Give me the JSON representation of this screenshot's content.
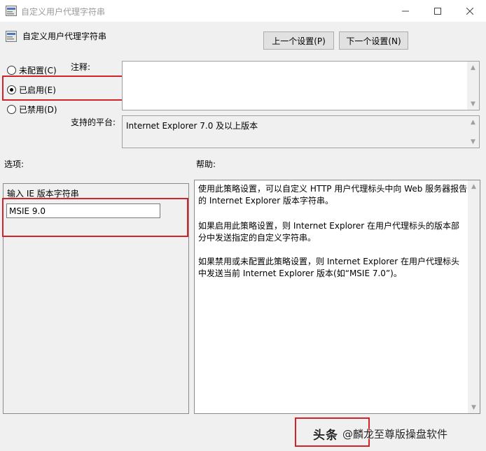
{
  "window": {
    "title": "自定义用户代理字符串",
    "controls": [
      "minimize-icon",
      "maximize-icon",
      "close-icon"
    ]
  },
  "header": {
    "title": "自定义用户代理字符串",
    "prev_button": "上一个设置(P)",
    "next_button": "下一个设置(N)"
  },
  "state": {
    "options": [
      {
        "label": "未配置(C)",
        "checked": false
      },
      {
        "label": "已启用(E)",
        "checked": true
      },
      {
        "label": "已禁用(D)",
        "checked": false
      }
    ]
  },
  "comment": {
    "label": "注释:",
    "value": ""
  },
  "platform": {
    "label": "支持的平台:",
    "value": "Internet Explorer 7.0 及以上版本"
  },
  "options_section": {
    "label": "选项:",
    "field_label": "输入 IE 版本字符串",
    "field_value": "MSIE 9.0"
  },
  "help_section": {
    "label": "帮助:",
    "paragraphs": [
      "使用此策略设置，可以自定义 HTTP 用户代理标头中向 Web 服务器报告的 Internet Explorer 版本字符串。",
      "如果启用此策略设置，则 Internet Explorer 在用户代理标头的版本部分中发送指定的自定义字符串。",
      "如果禁用或未配置此策略设置，则 Internet Explorer 在用户代理标头中发送当前 Internet Explorer 版本(如“MSIE 7.0”)。"
    ]
  },
  "watermark": {
    "logo": "头条",
    "handle": "@麟龙至尊版操盘软件"
  },
  "colors": {
    "highlight_red": "#d2232a",
    "dialog_bg": "#f0f0f0"
  }
}
